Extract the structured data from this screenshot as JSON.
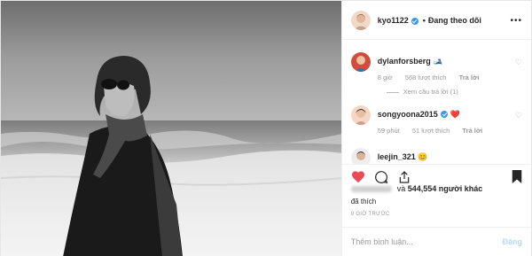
{
  "header": {
    "username": "kyo1122",
    "separator": "•",
    "follow_status": "Đang theo dõi",
    "more": "•••"
  },
  "comments": [
    {
      "username": "dylanforsberg",
      "emoji": "🎿",
      "time": "8 giờ",
      "likes": "568 lượt thích",
      "reply": "Trả lời",
      "view_replies": "Xem câu trả lời (1)"
    },
    {
      "username": "songyoona2015",
      "emoji": "❤️",
      "time": "59 phút",
      "likes": "51 lượt thích",
      "reply": "Trả lời"
    },
    {
      "username": "leejin_321",
      "emoji": "😊"
    }
  ],
  "likes": {
    "conj": "và",
    "count": "544,554 người khác",
    "line2": "đã thích"
  },
  "timestamp": "9 GIỜ TRƯỚC",
  "add_comment": {
    "placeholder": "Thêm bình luận...",
    "post": "Đăng"
  },
  "colors": {
    "like": "#ed4956",
    "verified": "#3897f0",
    "muted": "#999999",
    "post_disabled": "#b3dbff"
  }
}
